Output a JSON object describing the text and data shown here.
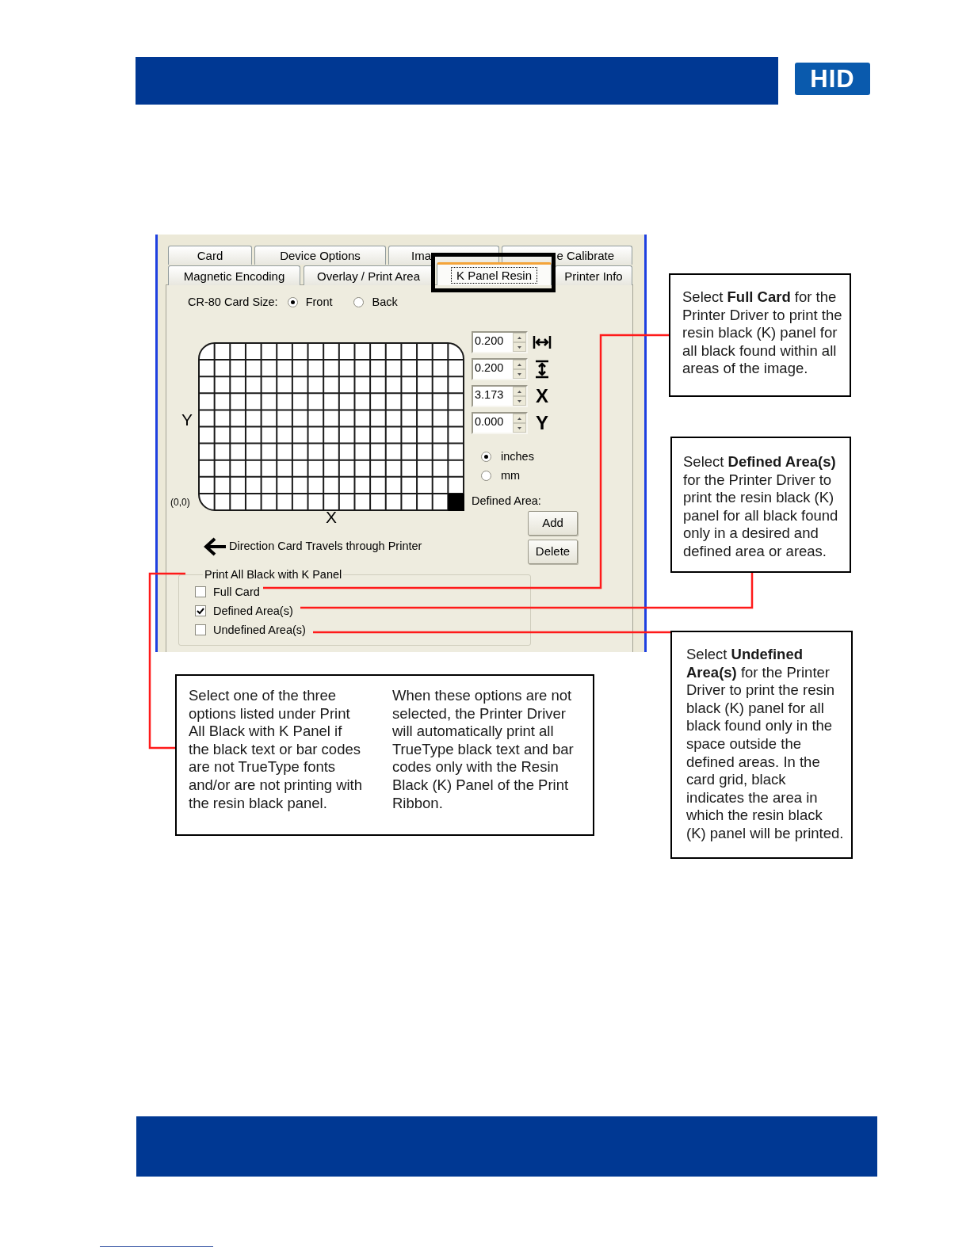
{
  "header": {
    "logo": "HID"
  },
  "dialog": {
    "tab_rows": [
      {
        "tabs": [
          {
            "label": "Card",
            "selected": false,
            "kind": "whole"
          },
          {
            "label": "Device Options",
            "selected": false,
            "kind": "whole"
          },
          {
            "label": "Ima",
            "selected": false,
            "kind": "head"
          },
          {
            "label": "e Calibrate",
            "selected": false,
            "kind": "tail"
          }
        ]
      },
      {
        "tabs": [
          {
            "label": "Magnetic Encoding",
            "selected": false,
            "kind": "whole"
          },
          {
            "label": "Overlay / Print Area",
            "selected": false,
            "kind": "whole"
          },
          {
            "label": "K Panel Resin",
            "selected": true,
            "kind": "whole"
          },
          {
            "label": "Printer Info",
            "selected": false,
            "kind": "whole"
          }
        ]
      }
    ],
    "card_size": {
      "label": "CR-80 Card Size:",
      "options": [
        {
          "label": "Front",
          "selected": true
        },
        {
          "label": "Back",
          "selected": false
        }
      ]
    },
    "grid": {
      "y_label": "Y",
      "x_label": "X",
      "origin_label": "(0,0)"
    },
    "direction": "Direction Card Travels through Printer",
    "fields": [
      {
        "kind": "width",
        "value": "0.200"
      },
      {
        "kind": "height",
        "value": "0.200"
      },
      {
        "kind": "x",
        "value": "3.173",
        "label": "X"
      },
      {
        "kind": "y",
        "value": "0.000",
        "label": "Y"
      }
    ],
    "units": [
      {
        "label": "inches",
        "selected": true
      },
      {
        "label": "mm",
        "selected": false
      }
    ],
    "defined_area": {
      "label": "Defined Area:",
      "buttons": [
        "Add",
        "Delete"
      ]
    },
    "group": {
      "title": "Print All Black with K Panel",
      "options": [
        {
          "label": "Full Card",
          "checked": false
        },
        {
          "label": "Defined Area(s)",
          "checked": true
        },
        {
          "label": "Undefined Area(s)",
          "checked": false
        }
      ]
    }
  },
  "callouts": [
    {
      "text": "Select **Full Card** for the Printer Driver to print the resin black (K) panel for all black found within all areas of the image."
    },
    {
      "text": "Select **Defined Area(s)** for the Printer Driver to print the resin black (K) panel for all black found only in a desired and defined area or areas."
    },
    {
      "text": "Select **Undefined Area(s)** for the Printer Driver to print the resin black (K) panel for all black found only in the space outside the defined areas. In the card grid, black indicates the area in which the resin black (K) panel will be printed."
    }
  ],
  "note": {
    "columns": [
      "Select one of the three options listed under Print All Black with K Panel if the black text or bar codes are not TrueType fonts and/or are not printing with the resin black panel.",
      "When these options are not selected, the Printer Driver will automatically print all TrueType black text and bar codes only with the Resin Black (K) Panel of the Print Ribbon."
    ]
  }
}
